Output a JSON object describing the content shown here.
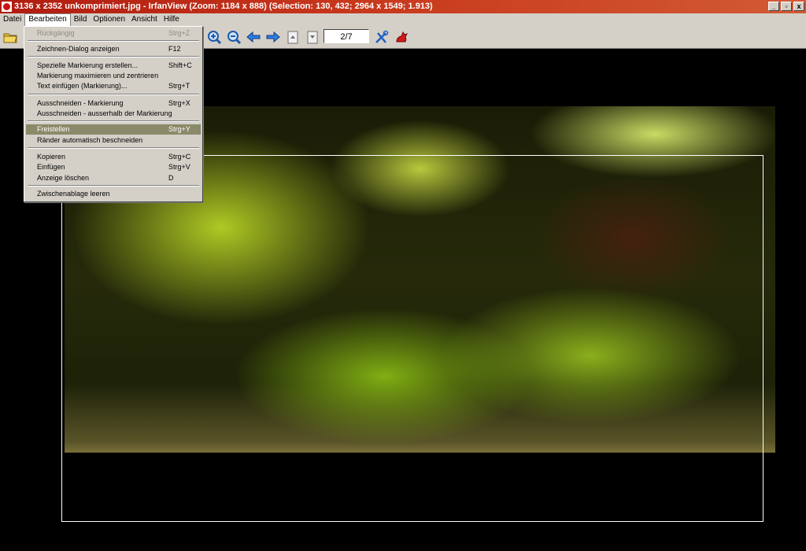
{
  "window": {
    "title": "3136 x 2352 unkomprimiert.jpg - IrfanView (Zoom: 1184 x 888) (Selection: 130, 432; 2964 x 1549; 1.913)",
    "controls": [
      "_",
      "1",
      "x"
    ]
  },
  "menubar": [
    "Datei",
    "Bearbeiten",
    "Bild",
    "Optionen",
    "Ansicht",
    "Hilfe"
  ],
  "toolbar": {
    "page": "2/7",
    "icons": [
      "open-folder-icon",
      "zoom-in-icon",
      "zoom-out-icon",
      "previous-arrow-icon",
      "next-arrow-icon",
      "first-page-icon",
      "last-page-icon",
      "settings-tools-icon",
      "irfanview-cat-icon"
    ]
  },
  "edit_menu": {
    "items": [
      {
        "label": "Rückgängig",
        "key": "Strg+Z",
        "state": "disabled"
      },
      {
        "label": "Zeichnen-Dialog anzeigen",
        "key": "F12"
      },
      {
        "label": "Spezielle Markierung erstellen...",
        "key": "Shift+C"
      },
      {
        "label": "Markierung maximieren und zentrieren",
        "key": ""
      },
      {
        "label": "Text einfügen (Markierung)...",
        "key": "Strg+T"
      },
      {
        "label": "Ausschneiden - Markierung",
        "key": "Strg+X"
      },
      {
        "label": "Ausschneiden - ausserhalb der Markierung",
        "key": ""
      },
      {
        "label": "Freistellen",
        "key": "Strg+Y",
        "state": "highlighted"
      },
      {
        "label": "Ränder automatisch beschneiden",
        "key": ""
      },
      {
        "label": "Kopieren",
        "key": "Strg+C"
      },
      {
        "label": "Einfügen",
        "key": "Strg+V"
      },
      {
        "label": "Anzeige löschen",
        "key": "D"
      },
      {
        "label": "Zwischenablage leeren",
        "key": ""
      }
    ]
  }
}
